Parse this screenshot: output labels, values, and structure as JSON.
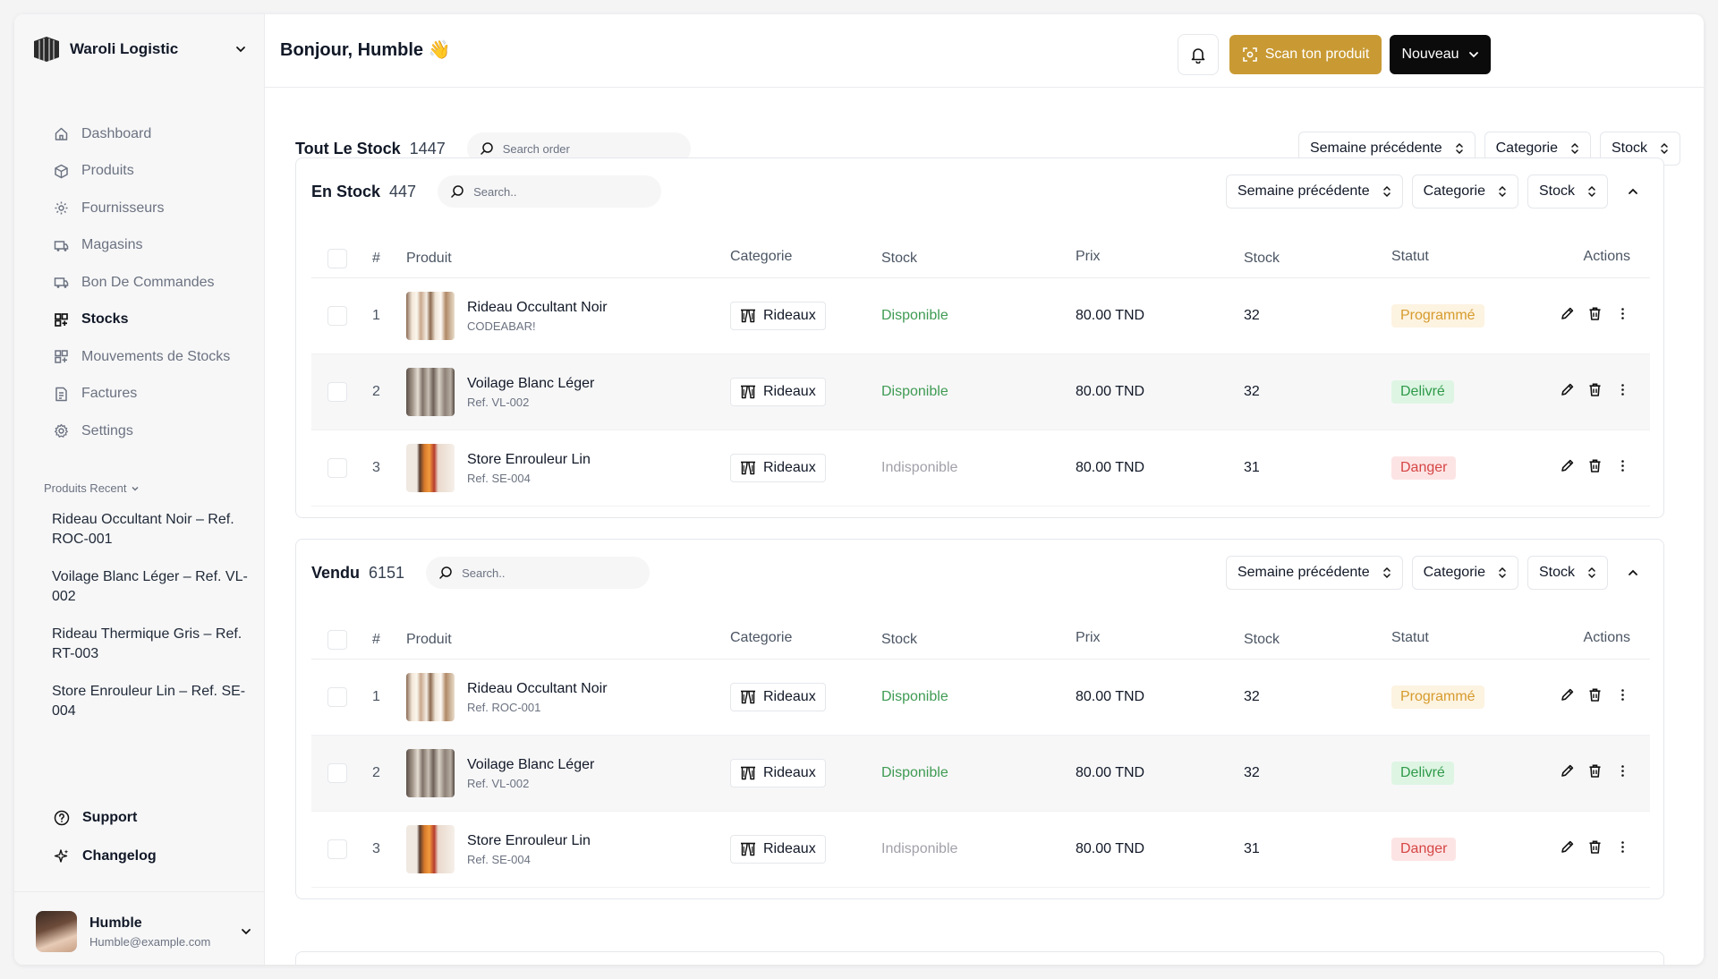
{
  "colors": {
    "accent": "#c99a33",
    "primary_dark": "#0b0b0b",
    "status_available": "#3f9b53",
    "status_unavailable": "#a1a1aa",
    "badge_programme_bg": "#fdf3e1",
    "badge_programme_fg": "#d69b2d",
    "badge_delivre_bg": "#def5e3",
    "badge_delivre_fg": "#2f9a4a",
    "badge_danger_bg": "#fde4e4",
    "badge_danger_fg": "#d64545"
  },
  "sidebar": {
    "brand": "Waroli Logistic",
    "nav": [
      {
        "label": "Dashboard",
        "icon": "home-icon",
        "active": false
      },
      {
        "label": "Produits",
        "icon": "box-icon",
        "active": false
      },
      {
        "label": "Fournisseurs",
        "icon": "supplier-icon",
        "active": false
      },
      {
        "label": "Magasins",
        "icon": "store-icon",
        "active": false
      },
      {
        "label": "Bon De Commandes",
        "icon": "order-icon",
        "active": false
      },
      {
        "label": "Stocks",
        "icon": "stocks-icon",
        "active": true
      },
      {
        "label": "Mouvements de Stocks",
        "icon": "movements-icon",
        "active": false
      },
      {
        "label": "Factures",
        "icon": "invoice-icon",
        "active": false
      },
      {
        "label": "Settings",
        "icon": "gear-icon",
        "active": false
      }
    ],
    "recent_label": "Produits Recent",
    "recent": [
      "Rideau Occultant Noir – Ref. ROC-001",
      "Voilage Blanc Léger – Ref. VL-002",
      "Rideau Thermique Gris – Ref. RT-003",
      "Store Enrouleur Lin – Ref. SE-004"
    ],
    "support": "Support",
    "changelog": "Changelog",
    "user": {
      "name": "Humble",
      "email": "Humble@example.com"
    }
  },
  "header": {
    "greeting": "Bonjour, Humble 👋",
    "scan_label": "Scan ton produit",
    "new_label": "Nouveau"
  },
  "overview": {
    "title": "Tout Le Stock",
    "count": "1447",
    "search_placeholder": "Search order",
    "filters": [
      "Semaine précédente",
      "Categorie",
      "Stock"
    ]
  },
  "table_headers": {
    "num": "#",
    "produit": "Produit",
    "categorie": "Categorie",
    "stock": "Stock",
    "prix": "Prix",
    "qty": "Stock",
    "statut": "Statut",
    "actions": "Actions"
  },
  "sections": [
    {
      "title": "En Stock",
      "count": "447",
      "search_placeholder": "Search..",
      "filters": [
        "Semaine précédente",
        "Categorie",
        "Stock"
      ],
      "rows": [
        {
          "num": "1",
          "name": "Rideau Occultant Noir",
          "ref": "CODEABAR!",
          "category": "Rideaux",
          "stock_status": "Disponible",
          "available": true,
          "price": "80.00 TND",
          "qty": "32",
          "status": "Programmé",
          "status_kind": "programme",
          "thumb": "rideau-noir"
        },
        {
          "num": "2",
          "name": "Voilage Blanc Léger",
          "ref": "Ref. VL-002",
          "category": "Rideaux",
          "stock_status": "Disponible",
          "available": true,
          "price": "80.00 TND",
          "qty": "32",
          "status": "Delivré",
          "status_kind": "delivre",
          "thumb": "voilage"
        },
        {
          "num": "3",
          "name": "Store Enrouleur Lin",
          "ref": "Ref. SE-004",
          "category": "Rideaux",
          "stock_status": "Indisponible",
          "available": false,
          "price": "80.00 TND",
          "qty": "31",
          "status": "Danger",
          "status_kind": "danger",
          "thumb": "store"
        }
      ]
    },
    {
      "title": "Vendu",
      "count": "6151",
      "search_placeholder": "Search..",
      "filters": [
        "Semaine précédente",
        "Categorie",
        "Stock"
      ],
      "rows": [
        {
          "num": "1",
          "name": "Rideau Occultant Noir",
          "ref": "Ref. ROC-001",
          "category": "Rideaux",
          "stock_status": "Disponible",
          "available": true,
          "price": "80.00 TND",
          "qty": "32",
          "status": "Programmé",
          "status_kind": "programme",
          "thumb": "rideau-noir"
        },
        {
          "num": "2",
          "name": "Voilage Blanc Léger",
          "ref": "Ref. VL-002",
          "category": "Rideaux",
          "stock_status": "Disponible",
          "available": true,
          "price": "80.00 TND",
          "qty": "32",
          "status": "Delivré",
          "status_kind": "delivre",
          "thumb": "voilage"
        },
        {
          "num": "3",
          "name": "Store Enrouleur Lin",
          "ref": "Ref. SE-004",
          "category": "Rideaux",
          "stock_status": "Indisponible",
          "available": false,
          "price": "80.00 TND",
          "qty": "31",
          "status": "Danger",
          "status_kind": "danger",
          "thumb": "store"
        }
      ]
    }
  ]
}
